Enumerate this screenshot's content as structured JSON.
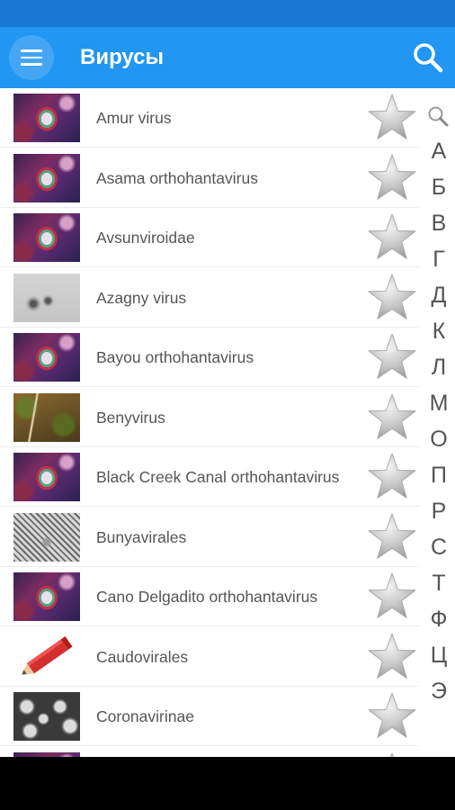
{
  "status_bar": {
    "color": "#1976d2"
  },
  "app_bar": {
    "title": "Вирусы",
    "color": "#2196f3",
    "menu_icon": "menu-icon",
    "search_icon": "search-icon"
  },
  "list": {
    "items": [
      {
        "label": "Amur virus",
        "thumbnail": "virus-illustration",
        "favorite": false
      },
      {
        "label": "Asama orthohantavirus",
        "thumbnail": "virus-illustration",
        "favorite": false
      },
      {
        "label": "Avsunviroidae",
        "thumbnail": "virus-illustration",
        "favorite": false
      },
      {
        "label": "Azagny virus",
        "thumbnail": "electron-micrograph",
        "favorite": false
      },
      {
        "label": "Bayou orthohantavirus",
        "thumbnail": "virus-illustration",
        "favorite": false
      },
      {
        "label": "Benyvirus",
        "thumbnail": "plant-photo",
        "favorite": false
      },
      {
        "label": "Black Creek Canal orthohantavirus",
        "thumbnail": "virus-illustration",
        "favorite": false
      },
      {
        "label": "Bunyavirales",
        "thumbnail": "electron-micrograph",
        "favorite": false
      },
      {
        "label": "Cano Delgadito orthohantavirus",
        "thumbnail": "virus-illustration",
        "favorite": false
      },
      {
        "label": "Caudovirales",
        "thumbnail": "pencil-icon",
        "favorite": false
      },
      {
        "label": "Coronavirinae",
        "thumbnail": "electron-micrograph",
        "favorite": false
      }
    ]
  },
  "alphabet_index": {
    "search_icon": "search-icon",
    "letters": [
      "А",
      "Б",
      "В",
      "Г",
      "Д",
      "К",
      "Л",
      "М",
      "О",
      "П",
      "Р",
      "С",
      "Т",
      "Ф",
      "Ц",
      "Э"
    ]
  },
  "nav_bar": {
    "color": "#000000"
  }
}
